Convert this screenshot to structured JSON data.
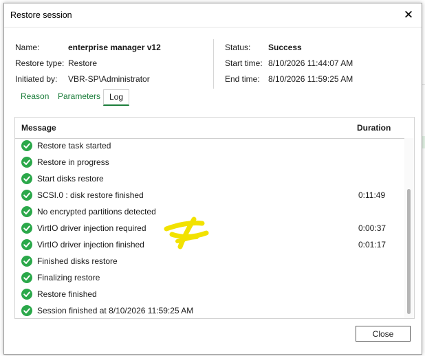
{
  "window": {
    "title": "Restore session"
  },
  "info": {
    "name_label": "Name:",
    "name_value": "enterprise manager v12",
    "restore_type_label": "Restore type:",
    "restore_type_value": "Restore",
    "initiated_by_label": "Initiated by:",
    "initiated_by_value": "VBR-SP\\Administrator",
    "status_label": "Status:",
    "status_value": "Success",
    "start_time_label": "Start time:",
    "start_time_value": "8/10/2026 11:44:07 AM",
    "end_time_label": "End time:",
    "end_time_value": "8/10/2026 11:59:25 AM"
  },
  "tabs": [
    {
      "label": "Reason",
      "active": false
    },
    {
      "label": "Parameters",
      "active": false
    },
    {
      "label": "Log",
      "active": true
    }
  ],
  "log": {
    "columns": {
      "message": "Message",
      "duration": "Duration"
    },
    "rows": [
      {
        "status": "success",
        "message": "Restore task started",
        "duration": ""
      },
      {
        "status": "success",
        "message": "Restore in progress",
        "duration": ""
      },
      {
        "status": "success",
        "message": "Start disks restore",
        "duration": ""
      },
      {
        "status": "success",
        "message": "SCSI.0 : disk restore finished",
        "duration": "0:11:49"
      },
      {
        "status": "success",
        "message": "No encrypted partitions detected",
        "duration": ""
      },
      {
        "status": "success",
        "message": "VirtIO driver injection required",
        "duration": "0:00:37"
      },
      {
        "status": "success",
        "message": "VirtIO driver injection finished",
        "duration": "0:01:17"
      },
      {
        "status": "success",
        "message": "Finished disks restore",
        "duration": ""
      },
      {
        "status": "success",
        "message": "Finalizing restore",
        "duration": ""
      },
      {
        "status": "success",
        "message": "Restore finished",
        "duration": ""
      },
      {
        "status": "success",
        "message": "Session finished at 8/10/2026 11:59:25 AM",
        "duration": ""
      }
    ]
  },
  "buttons": {
    "close_label": "Close"
  },
  "icons": {
    "close": "close-icon",
    "row_status": "success-check-icon"
  },
  "colors": {
    "accent_green": "#1b7d3a",
    "success_icon": "#2ba84a",
    "annotation_yellow": "#f2e200"
  }
}
